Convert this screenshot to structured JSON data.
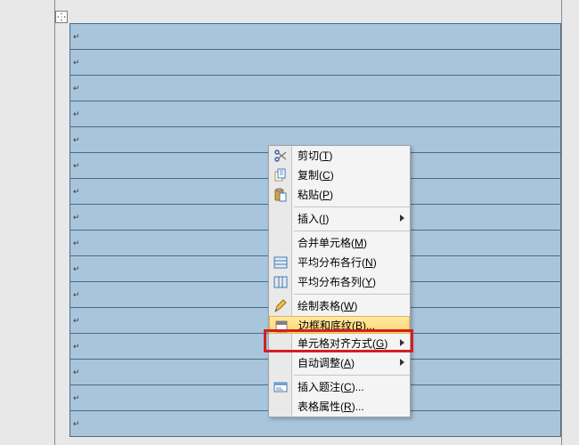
{
  "table": {
    "rows": 16,
    "cell_mark": "↵"
  },
  "menu": {
    "cut": {
      "label": "剪切",
      "accel": "T"
    },
    "copy": {
      "label": "复制",
      "accel": "C"
    },
    "paste": {
      "label": "粘贴",
      "accel": "P"
    },
    "insert": {
      "label": "插入",
      "accel": "I"
    },
    "merge": {
      "label": "合并单元格",
      "accel": "M"
    },
    "distribute_rows": {
      "label": "平均分布各行",
      "accel": "N"
    },
    "distribute_cols": {
      "label": "平均分布各列",
      "accel": "Y"
    },
    "draw_table": {
      "label": "绘制表格",
      "accel": "W"
    },
    "borders_shading": {
      "label": "边框和底纹",
      "accel": "B",
      "suffix": "..."
    },
    "cell_alignment": {
      "label": "单元格对齐方式",
      "accel": "G"
    },
    "autofit": {
      "label": "自动调整",
      "accel": "A"
    },
    "insert_caption": {
      "label": "插入题注",
      "accel": "C",
      "suffix": "..."
    },
    "table_properties": {
      "label": "表格属性",
      "accel": "R",
      "suffix": "..."
    }
  }
}
